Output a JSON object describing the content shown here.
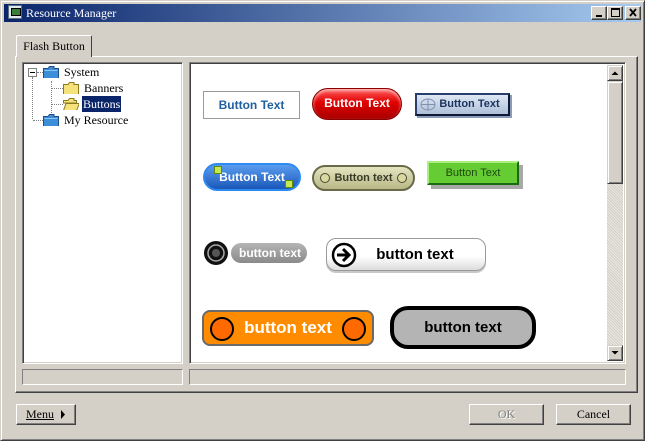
{
  "window": {
    "title": "Resource Manager"
  },
  "tabs": [
    {
      "label": "Flash Button"
    }
  ],
  "tree": {
    "items": [
      {
        "label": "System",
        "expanded": true,
        "level": 0
      },
      {
        "label": "Banners",
        "level": 1
      },
      {
        "label": "Buttons",
        "level": 1,
        "selected": true
      },
      {
        "label": "My Resource",
        "level": 0
      }
    ]
  },
  "preview": {
    "buttons": [
      {
        "style": "simple-outline",
        "text": "Button Text",
        "color": "#2060a0"
      },
      {
        "style": "red-glossy-pill",
        "text": "Button Text",
        "color": "#d80000"
      },
      {
        "style": "navy-beveled",
        "text": "Button Text",
        "color": "#2a3e6e"
      },
      {
        "style": "blue-capsule",
        "text": "Button Text",
        "color": "#1a58b8"
      },
      {
        "style": "olive-oval",
        "text": "Button text",
        "color": "#c8c890"
      },
      {
        "style": "green-3d",
        "text": "Button Text",
        "color": "#66cc33"
      },
      {
        "style": "grey-pill-with-disc",
        "text": "button text",
        "color": "#9a9a9a"
      },
      {
        "style": "white-arrow-pill",
        "text": "button text",
        "color": "#ffffff"
      },
      {
        "style": "orange-rounded",
        "text": "button text",
        "color": "#ff8c00"
      },
      {
        "style": "grey-thick-outline",
        "text": "button text",
        "color": "#b4b4b4"
      }
    ]
  },
  "footer": {
    "menu_label": "Menu",
    "ok_label": "OK",
    "cancel_label": "Cancel"
  }
}
